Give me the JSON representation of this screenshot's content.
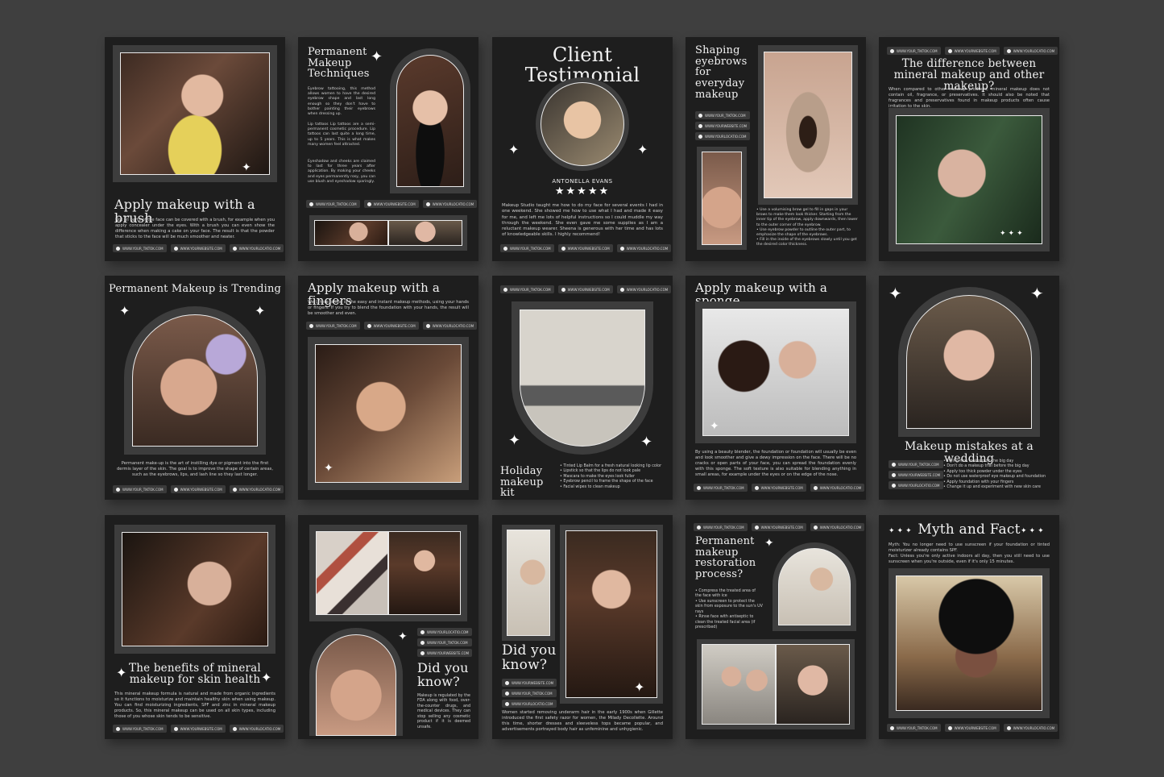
{
  "social": {
    "tiktok": "WWW.YOUR_TIKTOK.COM",
    "website": "WWW.YOURWEBSITE.COM",
    "location": "WWW.YOURLOCATIO.COM"
  },
  "cards": {
    "brush": {
      "title": "Apply makeup with a brush",
      "body": "Not all parts of the face can be covered with a brush, for example when you apply concealer under the eyes. With a brush you can even show the difference when making a cake on your face. The result is that the powder that sticks to the face will be much smoother and neater."
    },
    "techniques": {
      "title": "Permanent Makeup Techniques",
      "p1": "Eyebrow tattooing, this method allows women to have the desired eyebrow shape and last long enough so they don't have to bother painting their eyebrows when dressing up.",
      "p2": "Lip tattoos Lip tattoos are a semi-permanent cosmetic procedure. Lip tattoos can last quite a long time, up to 5 years. This is what makes many women feel attracted.",
      "p3": "Eyeshadow and cheeks are claimed to last for three years after application. By making your cheeks and eyes permanently rosy, you can use blush and eyeshadow sparingly."
    },
    "testimonial": {
      "title": "Client Testimonial",
      "name": "ANTONELLA EVANS",
      "stars": "★★★★★",
      "body": "Makeup Studio taught me how to do my face for several events I had in one weekend. She showed me how to use what I had and made it easy for me, and left me lots of helpful instructions so I could muddle my way through the weekend. She even gave me some supplies as I am a reluctant makeup wearer. Sheena is generous with her time and has lots of knowledgeable skills. I highly recommend!"
    },
    "eyebrows": {
      "title": "Shaping eyebrows for everyday makeup",
      "bullets": [
        "Use a volumising brow gel to fill in gaps in your brows to make them look thicker. Starting from the inner tip of the eyebrow, apply downwards, then lower to the outer corner of the eyebrow.",
        "Use eyebrow powder to outline the outer part, to emphasize the shape of the eyebrows.",
        "Fill in the inside of the eyebrows slowly until you get the desired color thickness."
      ]
    },
    "mineral_diff": {
      "title": "The difference between mineral makeup and other makeup?",
      "body": "When compared to other makeup products, mineral makeup does not contain oil, fragrance, or preservatives. It should also be noted that fragrances and preservatives found in makeup products often cause irritation to the skin."
    },
    "trending": {
      "title": "Permanent Makeup is Trending",
      "body": "Permanent make-up is the art of instilling dye or pigment into the first dermis layer of the skin. The goal is to improve the shape of certain areas, such as the eyebrows, lips, and lash line so they last longer."
    },
    "fingers": {
      "title": "Apply makeup with a fingers",
      "body": "Well, here is one of the easy and instant makeup methods, using your hands or fingers. If you try to blend the foundation with your hands, the result will be smoother and even."
    },
    "holiday": {
      "title": "Holiday makeup kit",
      "bullets": [
        "Tinted Lip Balm for a fresh natural looking lip color",
        "Lipstick so that the lips do not look pale",
        "Mascara to make the eyes look fuller",
        "Eyebrow pencil to frame the shape of the face",
        "Facial wipes to clean makeup"
      ]
    },
    "sponge": {
      "title": "Apply makeup with a sponge",
      "body": "By using a beauty blender, the foundation or foundation will usually be even and look smoother and give a dewy impression on the face. There will be no cracks or open parts of your face, you can spread the foundation evenly with this sponge. The soft texture is also suitable for blending anything in small areas, for example under the eyes or on the edge of the nose."
    },
    "wedding": {
      "title": "Makeup mistakes at a wedding",
      "bullets": [
        "Trying new makeup on the big day",
        "Don't do a makeup trial before the big day",
        "Apply too thick powder under the eyes",
        "Do not use waterproof eye makeup and foundation",
        "Apply foundation with your fingers",
        "Change it up and experiment with new skin care"
      ]
    },
    "benefits": {
      "title": "The benefits of mineral makeup for skin health",
      "body": "This mineral makeup formula is natural and made from organic ingredients so it functions to moisturize and maintain healthy skin when using makeup. You can find moisturizing ingredients, SPF and zinc in mineral makeup products. So, this mineral makeup can be used on all skin types, including those of you whose skin tends to be sensitive."
    },
    "didyouknow1": {
      "title": "Did you know?",
      "body": "Makeup is regulated by the FDA along with food, over-the-counter drugs, and medical devices. They can stop selling any cosmetic product if it is deemed unsafe."
    },
    "didyouknow2": {
      "title": "Did you know?",
      "body": "Women started removing underarm hair in the early 1900s when Gillette introduced the first safety razor for women, the Milady Decollette. Around this time, shorter dresses and sleeveless tops became popular, and advertisements portrayed body hair as unfeminine and unhygienic."
    },
    "restoration": {
      "title": "Permanent makeup restoration process?",
      "bullets": [
        "Compress the treated area of the face with ice",
        "Use sunscreen to protect the skin from exposure to the sun's UV rays",
        "Rinse face with antiseptic to clean the treated facial area (if prescribed)"
      ]
    },
    "myth": {
      "title": "Myth and Fact",
      "myth": "Myth: You no longer need to use sunscreen if your foundation or tinted moisturizer already contains SPF.",
      "fact": "Fact: Unless you're only active indoors all day, then you still need to use sunscreen when you're outside, even if it's only 15 minutes."
    }
  }
}
